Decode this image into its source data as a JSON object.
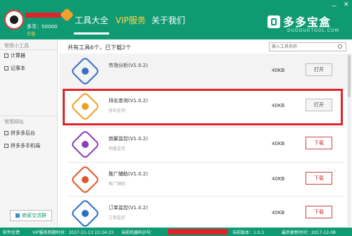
{
  "header": {
    "coins_label": "多币：50000",
    "coins_sub": "充值",
    "nav": [
      {
        "label": "工具大全",
        "active": true
      },
      {
        "label": "VIP服务",
        "active": false
      },
      {
        "label": "关于我们",
        "active": false
      }
    ],
    "logo_text": "多多宝盒",
    "logo_sub": "DUODUOTOOL.COM",
    "window_controls": [
      "－",
      "✕"
    ]
  },
  "sidebar": {
    "section1_title": "常用小工具",
    "section1_items": [
      "计算器",
      "记事本"
    ],
    "section2_title": "常用网址",
    "section2_items": [
      "拼多多后台",
      "拼多多手机端"
    ],
    "group_button": "商家交流群"
  },
  "main": {
    "summary": "共有工具6个，已下载2个",
    "search_placeholder": "输入工具名称",
    "tools": [
      {
        "name": "市场分析(V1.0.2)",
        "desc": "",
        "size": "40KB",
        "action": "打开",
        "action_type": "open",
        "icon": "crosshair-icon",
        "color": "#3a6fc2"
      },
      {
        "name": "排名查询(V1.0.2)",
        "desc": "排名查询",
        "size": "40KB",
        "action": "打开",
        "action_type": "open",
        "icon": "bar-chart-icon",
        "color": "#f0a020"
      },
      {
        "name": "销量监控(V1.0.2)",
        "desc": "销量监控",
        "size": "40KB",
        "action": "下载",
        "action_type": "download",
        "icon": "pulse-icon",
        "color": "#8a3fb8"
      },
      {
        "name": "推广辅助(V1.0.2)",
        "desc": "推广辅助",
        "size": "40KB",
        "action": "下载",
        "action_type": "download",
        "icon": "share-icon",
        "color": "#e0572a"
      },
      {
        "name": "订单监控(V1.0.2)",
        "desc": "订单监控",
        "size": "40KB",
        "action": "下载",
        "action_type": "download",
        "icon": "list-icon",
        "color": "#2a6fc2"
      }
    ]
  },
  "status": {
    "feedback": "软件反馈",
    "vip_expire": "VIP服务到期时间：2027-11-13 22:34:23",
    "device_code": "当前机器码识号：",
    "version": "当前版本：1.0.1",
    "last_update": "最后更新时间：2017-12-08"
  }
}
